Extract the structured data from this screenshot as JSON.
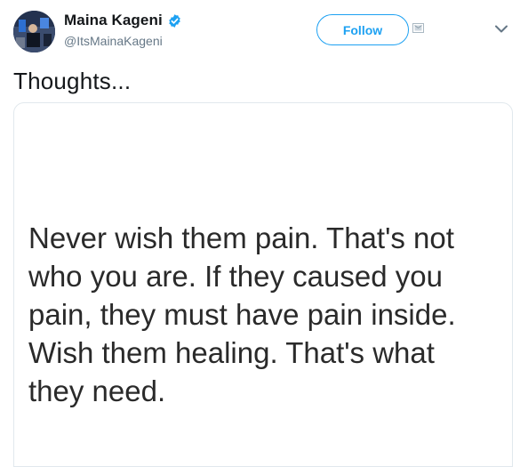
{
  "tweet": {
    "author": {
      "display_name": "Maina Kageni",
      "handle": "@ItsMainaKageni",
      "verified": true
    },
    "follow_label": "Follow",
    "text": "Thoughts...",
    "image_quote": "Never wish them pain. That's not\nwho you are. If they caused you\npain, they must have pain inside.\nWish them healing. That's what\nthey need."
  },
  "icons": {
    "verified": "verified-badge-icon",
    "follow_extra": "dm-icon",
    "more": "chevron-down-icon"
  },
  "colors": {
    "accent": "#1da1f2",
    "text": "#14171a",
    "muted": "#657786"
  }
}
